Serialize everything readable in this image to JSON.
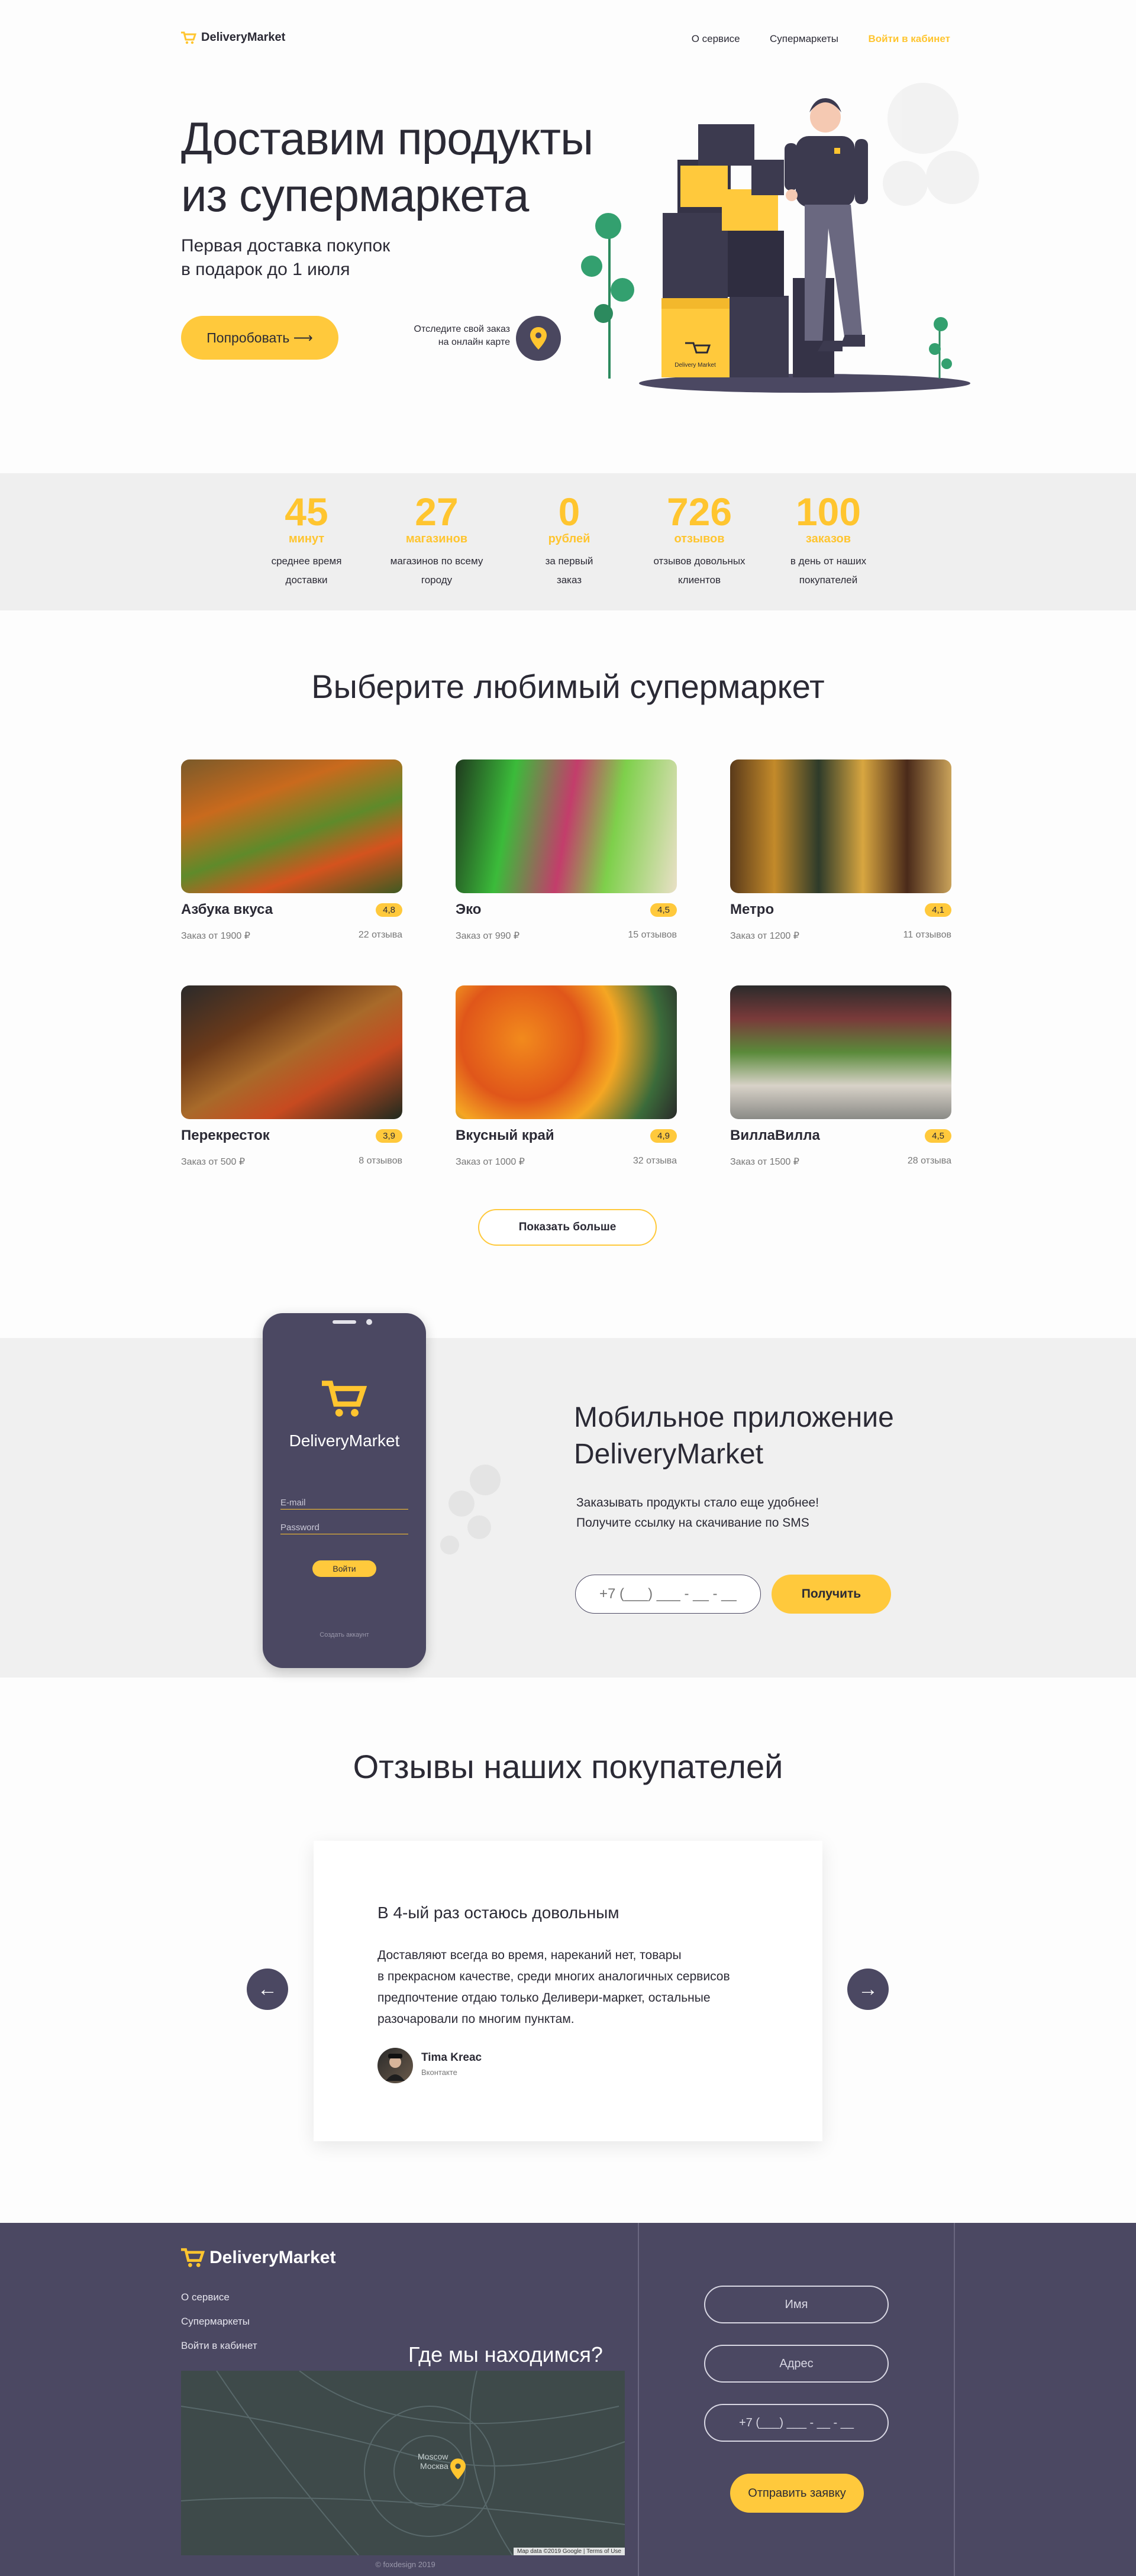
{
  "header": {
    "logo_text": "DeliveryMarket",
    "nav": [
      {
        "label": "О сервисе"
      },
      {
        "label": "Супермаркеты"
      },
      {
        "label": "Войти в кабинет"
      }
    ]
  },
  "hero": {
    "title_line1": "Доставим продукты",
    "title_line2": "из супермаркета",
    "subtitle_line1": "Первая доставка покупок",
    "subtitle_line2": "в подарок до 1 июля",
    "cta_label": "Попробовать ⟶",
    "track_line1": "Отследите свой заказ",
    "track_line2": "на онлайн карте",
    "box_label": "Delivery Market"
  },
  "stats": [
    {
      "num": "45",
      "unit": "минут",
      "desc1": "среднее время",
      "desc2": "доставки"
    },
    {
      "num": "27",
      "unit": "магазинов",
      "desc1": "магазинов по всему",
      "desc2": "городу"
    },
    {
      "num": "0",
      "unit": "рублей",
      "desc1": "за первый",
      "desc2": "заказ"
    },
    {
      "num": "726",
      "unit": "отзывов",
      "desc1": "отзывов довольных",
      "desc2": "клиентов"
    },
    {
      "num": "100",
      "unit": "заказов",
      "desc1": "в день от наших",
      "desc2": "покупателей"
    }
  ],
  "markets": {
    "title": "Выберите любимый супермаркет",
    "more_label": "Показать больше",
    "cards": [
      {
        "name": "Азбука вкуса",
        "rating": "4,8",
        "min": "Заказ от 1900 ₽",
        "reviews": "22 отзыва"
      },
      {
        "name": "Эко",
        "rating": "4,5",
        "min": "Заказ от 990 ₽",
        "reviews": "15 отзывов"
      },
      {
        "name": "Метро",
        "rating": "4,1",
        "min": "Заказ от 1200 ₽",
        "reviews": "11 отзывов"
      },
      {
        "name": "Перекресток",
        "rating": "3,9",
        "min": "Заказ от 500 ₽",
        "reviews": "8 отзывов"
      },
      {
        "name": "Вкусный край",
        "rating": "4,9",
        "min": "Заказ от 1000 ₽",
        "reviews": "32 отзыва"
      },
      {
        "name": "ВиллаВилла",
        "rating": "4,5",
        "min": "Заказ от 1500 ₽",
        "reviews": "28 отзыва"
      }
    ]
  },
  "app": {
    "phone_logo": "DeliveryMarket",
    "email_placeholder": "E-mail",
    "password_placeholder": "Password",
    "login_label": "Войти",
    "forgot_label": "Создать аккаунт",
    "title_line1": "Мобильное приложение",
    "title_line2": "DeliveryMarket",
    "text_line1": "Заказывать продукты стало еще удобнее!",
    "text_line2": "Получите ссылку на скачивание по SMS",
    "phone_placeholder": "+7 (___) ___ - __ - __",
    "get_label": "Получить"
  },
  "reviews": {
    "title": "Отзывы наших покупателей",
    "card_title": "В 4-ый раз остаюсь довольным",
    "text_line1": "Доставляют всегда во время, нареканий нет, товары",
    "text_line2": "в прекрасном качестве, среди многих аналогичных сервисов",
    "text_line3": "предпочтение отдаю только Деливери-маркет, остальные",
    "text_line4": "разочаровали по многим пунктам.",
    "author": "Tima Kreac",
    "source": "Вконтакте",
    "prev": "←",
    "next": "→"
  },
  "footer": {
    "logo_text": "DeliveryMarket",
    "links": [
      {
        "label": "О сервисе"
      },
      {
        "label": "Супермаркеты"
      },
      {
        "label": "Войти в кабинет"
      }
    ],
    "map_title": "Где мы находимся?",
    "map_city_ru": "Москва",
    "map_city_en": "Moscow",
    "map_attrib": "Map data ©2019 Google | Terms of Use",
    "name_placeholder": "Имя",
    "address_placeholder": "Адрес",
    "phone_placeholder": "+7 (___) ___ - __ - __",
    "submit_label": "Отправить заявку",
    "copyright": "© foxdesign 2019"
  },
  "colors": {
    "accent": "#ffc93c",
    "dark": "#4b4862",
    "text": "#2b2a35"
  }
}
